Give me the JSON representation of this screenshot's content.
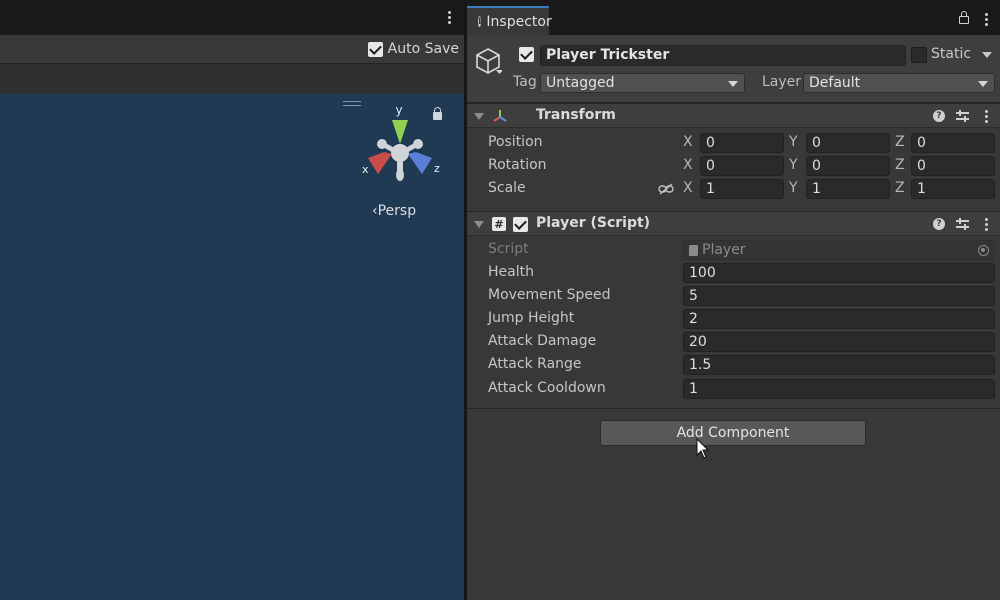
{
  "scene": {
    "autosave_label": "Auto Save",
    "autosave_checked": true,
    "gizmo": {
      "y_label": "y",
      "x_label": "x",
      "z_label": "z"
    },
    "persp_label": "‹Persp"
  },
  "inspector": {
    "tab_label": "Inspector",
    "gameobject": {
      "active": true,
      "name": "Player Trickster",
      "static_label": "Static",
      "tag_label": "Tag",
      "tag_value": "Untagged",
      "layer_label": "Layer",
      "layer_value": "Default"
    },
    "transform": {
      "title": "Transform",
      "position_label": "Position",
      "rotation_label": "Rotation",
      "scale_label": "Scale",
      "axis_x": "X",
      "axis_y": "Y",
      "axis_z": "Z",
      "position": {
        "x": "0",
        "y": "0",
        "z": "0"
      },
      "rotation": {
        "x": "0",
        "y": "0",
        "z": "0"
      },
      "scale": {
        "x": "1",
        "y": "1",
        "z": "1"
      }
    },
    "player_script": {
      "title": "Player (Script)",
      "enabled": true,
      "script_label": "Script",
      "script_value": "Player",
      "props": [
        {
          "label": "Health",
          "value": "100"
        },
        {
          "label": "Movement Speed",
          "value": "5"
        },
        {
          "label": "Jump Height",
          "value": "2"
        },
        {
          "label": "Attack Damage",
          "value": "20"
        },
        {
          "label": "Attack Range",
          "value": "1.5"
        },
        {
          "label": "Attack Cooldown",
          "value": "1"
        }
      ]
    },
    "add_component_label": "Add Component"
  },
  "colors": {
    "viewport": "#203a54",
    "panel": "#383838",
    "accent": "#3a79bb",
    "gizmo_y": "#8fd14f",
    "gizmo_x": "#d9534f",
    "gizmo_z": "#5b7fd6"
  }
}
